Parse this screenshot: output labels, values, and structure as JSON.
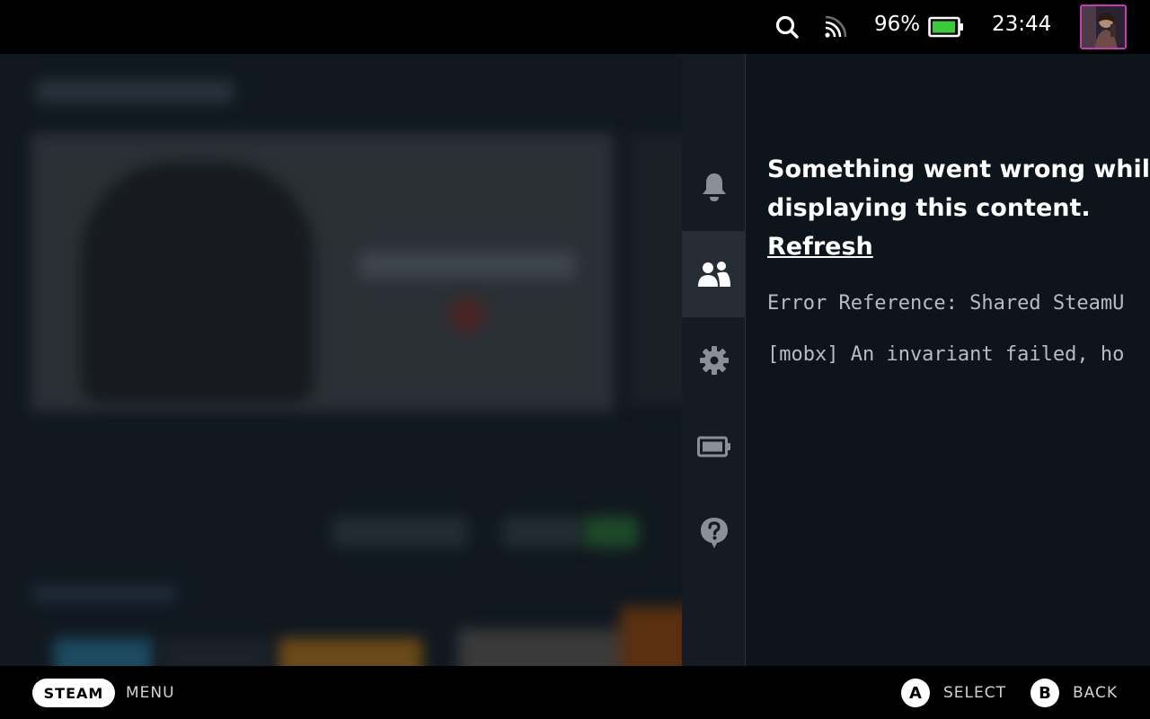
{
  "status_bar": {
    "battery_percent": "96%",
    "battery_level": 0.96,
    "time": "23:44",
    "icons": [
      "search-icon",
      "wifi-icon",
      "battery-icon",
      "avatar"
    ]
  },
  "side_panel": {
    "rail_items": [
      {
        "icon": "bell-icon",
        "active": false
      },
      {
        "icon": "friends-icon",
        "active": true
      },
      {
        "icon": "gear-icon",
        "active": false
      },
      {
        "icon": "battery-icon",
        "active": false
      },
      {
        "icon": "help-icon",
        "active": false
      }
    ],
    "error": {
      "line1": "Something went wrong while",
      "line2": "displaying this content.",
      "refresh_label": "Refresh",
      "reference": "Error Reference: Shared SteamU",
      "detail": "[mobx] An invariant failed, ho"
    }
  },
  "bottom_bar": {
    "steam_label": "STEAM",
    "menu_label": "MENU",
    "a_button": "A",
    "select_label": "SELECT",
    "b_button": "B",
    "back_label": "BACK"
  },
  "colors": {
    "panel_bg": "#0e141b",
    "rail_bg": "#151b22",
    "rail_active": "#262d35",
    "battery_green": "#3cc93c",
    "avatar_border": "#c23fb0"
  }
}
